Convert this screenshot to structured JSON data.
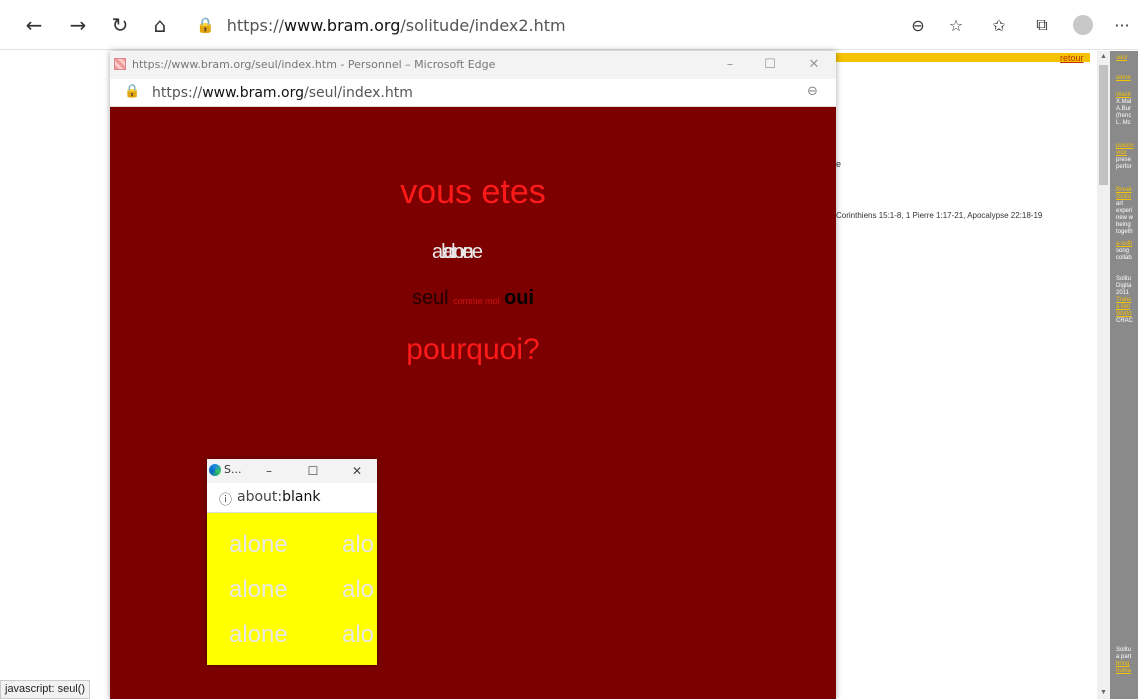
{
  "browser": {
    "url_prefix": "https://",
    "url_domain": "www.bram.org",
    "url_path": "/solitude/index2.htm",
    "icons": {
      "back": "back-arrow-icon",
      "forward": "forward-arrow-icon",
      "refresh": "refresh-icon",
      "home": "home-icon",
      "lock": "lock-icon",
      "zoom": "zoom-out-icon",
      "add_favorite": "add-favorite-icon",
      "favorites": "favorites-icon",
      "collections": "collections-icon",
      "profile": "profile-icon",
      "more": "more-icon"
    }
  },
  "background_page": {
    "retour": "retour",
    "fragment_e": "e",
    "references": "Corinthiens 15:1-8, 1 Pierre 1:17-21, Apocalypse 22:18-19",
    "accent_color": "#f4c200"
  },
  "sidebar": {
    "lines": [
      {
        "text": "seul",
        "link": true
      },
      {
        "text": "alone",
        "link": true
      },
      {
        "text": "réacti",
        "link": true
      },
      {
        "text": "X.Mal",
        "link": false
      },
      {
        "text": "A.Bur",
        "link": false
      },
      {
        "text": "(frenc",
        "link": false
      },
      {
        "text": "L. Mc",
        "link": false
      },
      {
        "text": "poison",
        "link": true
      },
      {
        "text": "voix",
        "link": true
      },
      {
        "text": "prese",
        "link": false
      },
      {
        "text": "perfor",
        "link": false
      },
      {
        "text": "Break",
        "link": true
      },
      {
        "text": "Solitu",
        "link": true
      },
      {
        "text": "art",
        "link": false
      },
      {
        "text": "experi",
        "link": false
      },
      {
        "text": "new w",
        "link": false
      },
      {
        "text": "being",
        "link": false
      },
      {
        "text": "togeth",
        "link": false
      },
      {
        "text": "a-solit",
        "link": true
      },
      {
        "text": "song",
        "link": false
      },
      {
        "text": "collab",
        "link": false
      },
      {
        "text": "Solitu",
        "link": false
      },
      {
        "text": "Digita",
        "link": false
      },
      {
        "text": "2011",
        "link": false
      },
      {
        "text": "Trans",
        "link": true
      },
      {
        "text": "a Bet",
        "link": true
      },
      {
        "text": "World",
        "link": true
      },
      {
        "text": "CRAC",
        "link": false
      },
      {
        "text": "Solitu",
        "link": false
      },
      {
        "text": "a part",
        "link": false
      },
      {
        "text": "bring",
        "link": true
      },
      {
        "text": "huma",
        "link": true
      }
    ]
  },
  "statusbar": {
    "text": "javascript: seul()"
  },
  "popup1": {
    "title": "https://www.bram.org/seul/index.htm - Personnel – Microsoft Edge",
    "url_prefix": "https://",
    "url_domain": "www.bram.org",
    "url_path": "/seul/index.htm",
    "background_color": "#7d0000",
    "vous_etes": "vous etes",
    "overlap_a": "alone",
    "overlap_b": "alone",
    "seul": "seul",
    "comme_moi": "comme moi",
    "oui": "oui",
    "pourquoi": "pourquoi?"
  },
  "popup2": {
    "title": "S...",
    "url_prefix": "about:",
    "url_rest": "blank",
    "background_color": "#ffff00",
    "words": [
      [
        "alone",
        "alo"
      ],
      [
        "alone",
        "alo"
      ],
      [
        "alone",
        "alo"
      ]
    ]
  },
  "window_controls": {
    "minimize": "–",
    "maximize": "☐",
    "close": "✕"
  }
}
